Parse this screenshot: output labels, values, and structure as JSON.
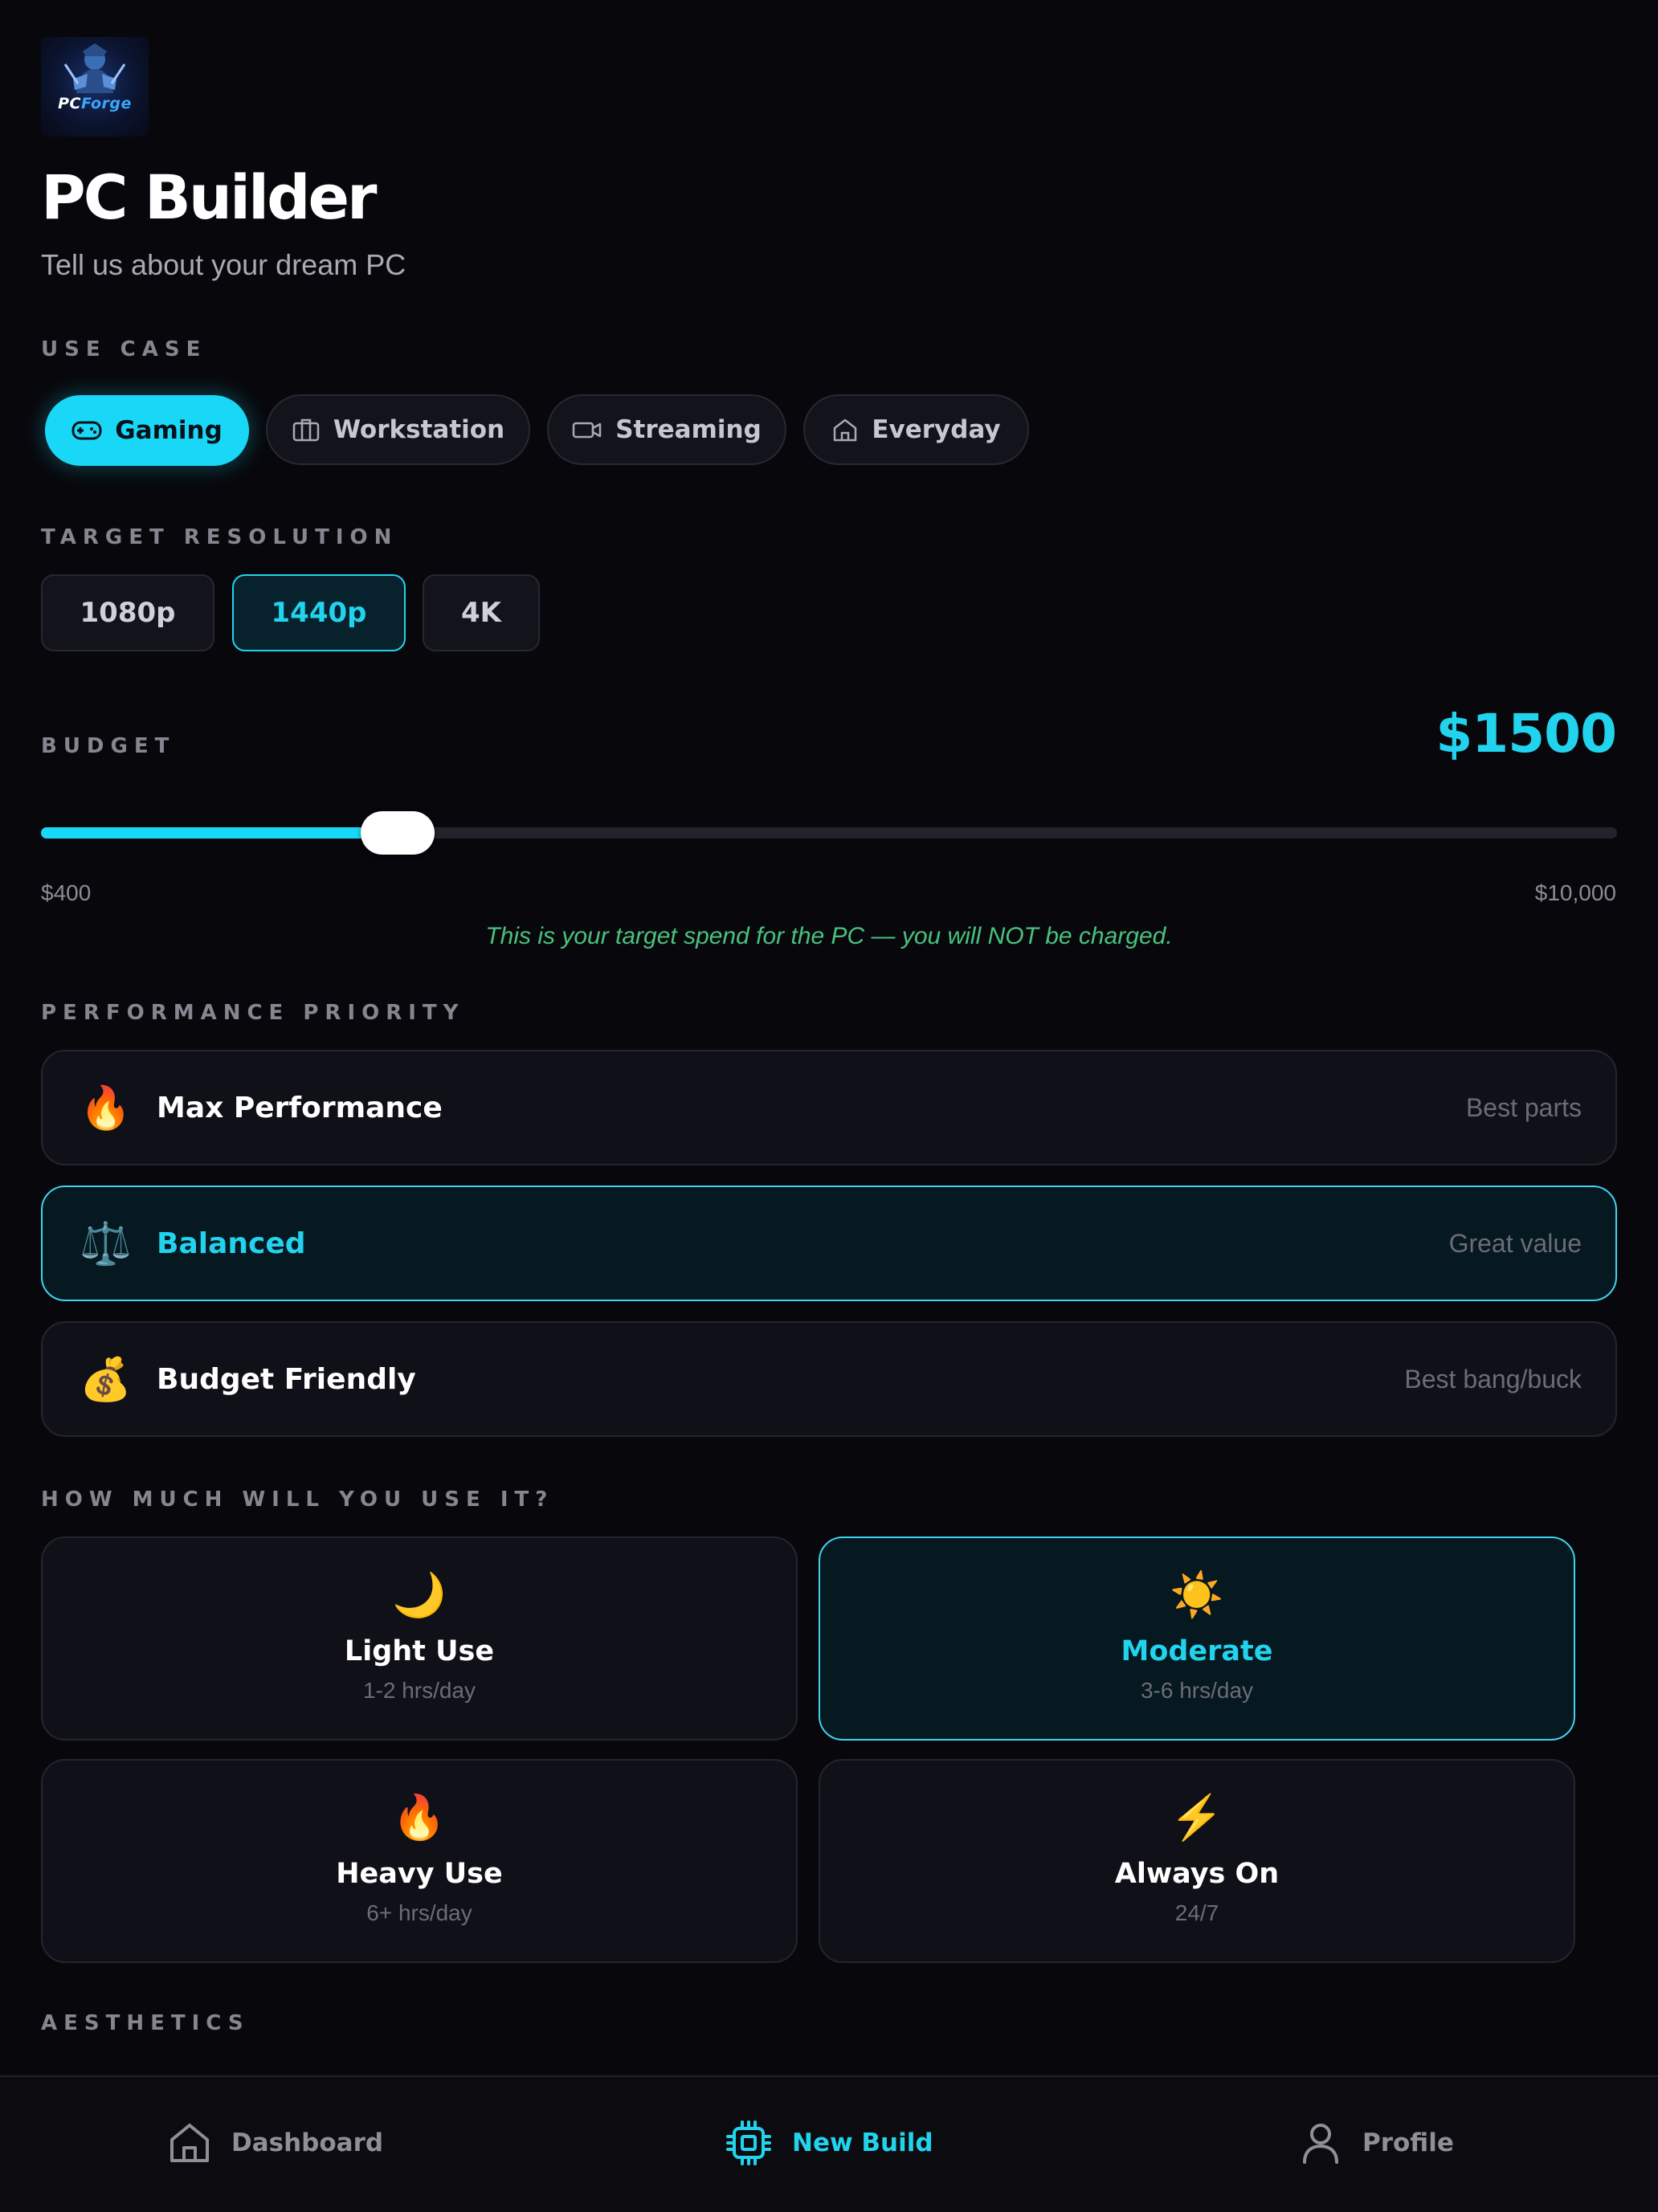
{
  "logo": {
    "text_pc": "PC",
    "text_forge": "Forge"
  },
  "header": {
    "title": "PC Builder",
    "subtitle": "Tell us about your dream PC"
  },
  "use_case": {
    "label": "USE CASE",
    "options": [
      {
        "label": "Gaming",
        "icon": "gamepad-icon",
        "selected": true
      },
      {
        "label": "Workstation",
        "icon": "briefcase-icon",
        "selected": false
      },
      {
        "label": "Streaming",
        "icon": "video-camera-icon",
        "selected": false
      },
      {
        "label": "Everyday",
        "icon": "home-icon",
        "selected": false
      }
    ]
  },
  "resolution": {
    "label": "TARGET RESOLUTION",
    "options": [
      {
        "label": "1080p",
        "selected": false
      },
      {
        "label": "1440p",
        "selected": true
      },
      {
        "label": "4K",
        "selected": false
      }
    ]
  },
  "budget": {
    "label": "BUDGET",
    "value_display": "$1500",
    "value": 1500,
    "min_label": "$400",
    "max_label": "$10,000",
    "min": 400,
    "max": 10000,
    "note": "This is your target spend for the PC — you will NOT be charged."
  },
  "performance": {
    "label": "PERFORMANCE PRIORITY",
    "options": [
      {
        "emoji": "🔥",
        "title": "Max Performance",
        "subtitle": "Best parts",
        "selected": false
      },
      {
        "emoji": "⚖️",
        "title": "Balanced",
        "subtitle": "Great value",
        "selected": true
      },
      {
        "emoji": "💰",
        "title": "Budget Friendly",
        "subtitle": "Best bang/buck",
        "selected": false
      }
    ]
  },
  "usage": {
    "label": "HOW MUCH WILL YOU USE IT?",
    "options": [
      {
        "emoji": "🌙",
        "title": "Light Use",
        "subtitle": "1-2 hrs/day",
        "selected": false
      },
      {
        "emoji": "☀️",
        "title": "Moderate",
        "subtitle": "3-6 hrs/day",
        "selected": true
      },
      {
        "emoji": "🔥",
        "title": "Heavy Use",
        "subtitle": "6+ hrs/day",
        "selected": false
      },
      {
        "emoji": "⚡",
        "title": "Always On",
        "subtitle": "24/7",
        "selected": false
      }
    ]
  },
  "aesthetics": {
    "label": "AESTHETICS"
  },
  "nav": {
    "items": [
      {
        "label": "Dashboard",
        "icon": "home-icon",
        "active": false
      },
      {
        "label": "New Build",
        "icon": "cpu-chip-icon",
        "active": true
      },
      {
        "label": "Profile",
        "icon": "user-icon",
        "active": false
      }
    ]
  },
  "colors": {
    "accent": "#22d3ee",
    "background": "#08080c",
    "card": "#101118",
    "note_green": "#49c17e"
  }
}
